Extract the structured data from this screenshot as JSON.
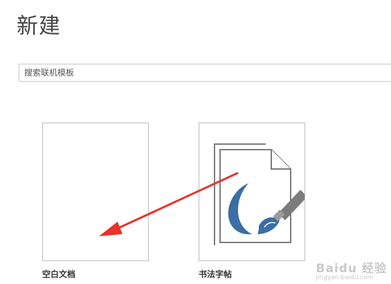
{
  "header": {
    "title": "新建"
  },
  "search": {
    "placeholder": "搜索联机模板",
    "value": ""
  },
  "templates": [
    {
      "label": "空白文档",
      "thumbnail": "blank-page"
    },
    {
      "label": "书法字帖",
      "thumbnail": "calligraphy-page-brush-icon"
    }
  ],
  "annotation": {
    "type": "red-arrow",
    "color": "#e8322b",
    "points_to": "空白文档"
  },
  "watermark": {
    "text": "Baidu 经验",
    "url": "jingyan.baidu.com"
  },
  "colors": {
    "brush_blue": "#3a6ea5",
    "outline_gray": "#7b7b7b"
  }
}
